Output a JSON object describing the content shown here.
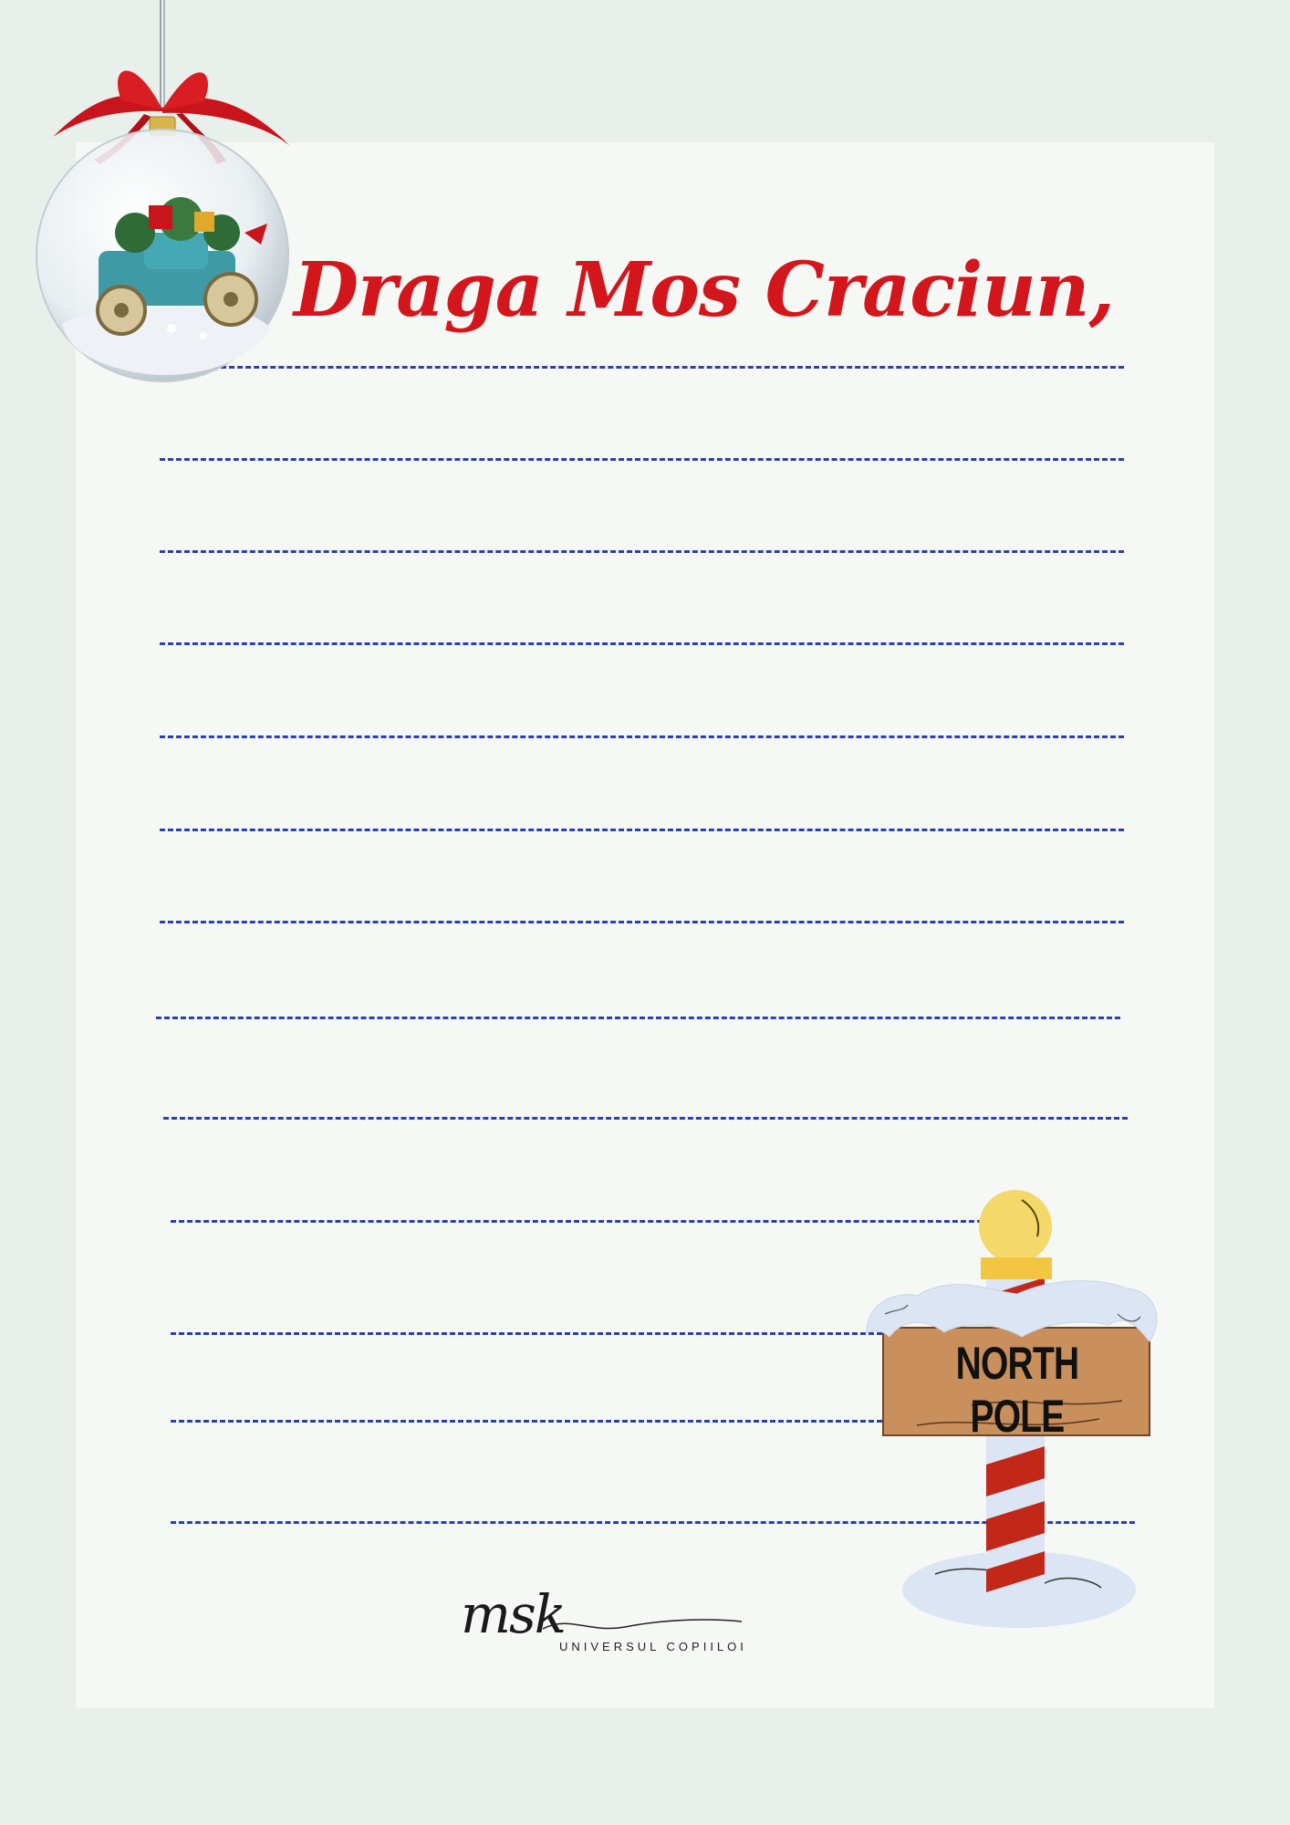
{
  "letter": {
    "greeting": "Draga Mos Craciun,",
    "ruled_line_count": 13
  },
  "sign": {
    "label": "NORTH POLE"
  },
  "logo": {
    "mark": "msk",
    "tagline": "UNIVERSUL COPIILOI"
  },
  "colors": {
    "background": "#e9efeb",
    "sheet": "#f6f8f5",
    "title_red": "#d3161c",
    "rule_blue": "#2a3fb0"
  },
  "decorations": {
    "ornament": "christmas-ornament-icon",
    "signpost": "north-pole-signpost-icon"
  }
}
